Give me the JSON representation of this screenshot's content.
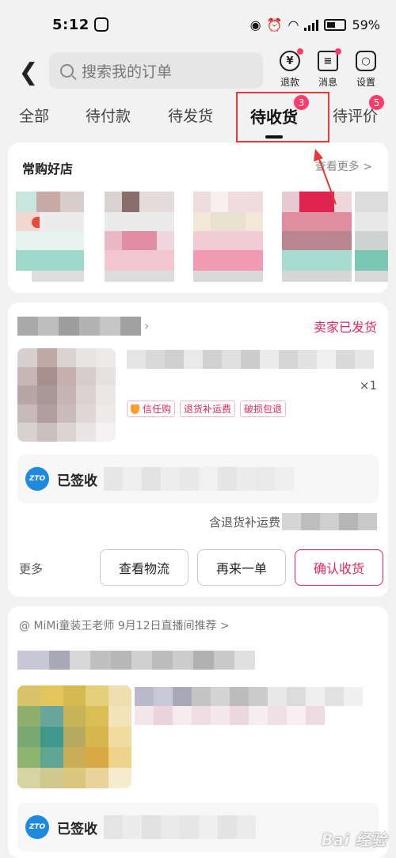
{
  "status_bar": {
    "time": "5:12",
    "battery": "59%",
    "network": "4G"
  },
  "header": {
    "search_placeholder": "搜索我的订单",
    "refund_label": "退款",
    "refund_icon_glyph": "¥",
    "messages_label": "消息",
    "settings_label": "设置"
  },
  "tabs": [
    {
      "label": "全部"
    },
    {
      "label": "待付款"
    },
    {
      "label": "待发货"
    },
    {
      "label": "待收货",
      "badge": "3"
    },
    {
      "label": "待评价",
      "badge": "5"
    }
  ],
  "shops_card": {
    "title": "常购好店",
    "more": "查看更多 >"
  },
  "order1": {
    "status": "卖家已发货",
    "quantity": "×1",
    "tags": [
      "信任购",
      "退货补运费",
      "破损包退"
    ],
    "courier_logo": "ZTO",
    "logistics_status": "已签收",
    "fee_label": "含退货补运费",
    "more": "更多",
    "buttons": {
      "logistics": "查看物流",
      "reorder": "再来一单",
      "confirm": "确认收货"
    }
  },
  "order2": {
    "live_recommend": "@ MiMi童装王老师  9月12日直播间推荐 >",
    "courier_logo": "ZTO",
    "logistics_status": "已签收"
  },
  "colors": {
    "accent": "#e0285c",
    "badge": "#ff3b6b",
    "annotation": "#e53935"
  },
  "watermark": "Bai 经验"
}
